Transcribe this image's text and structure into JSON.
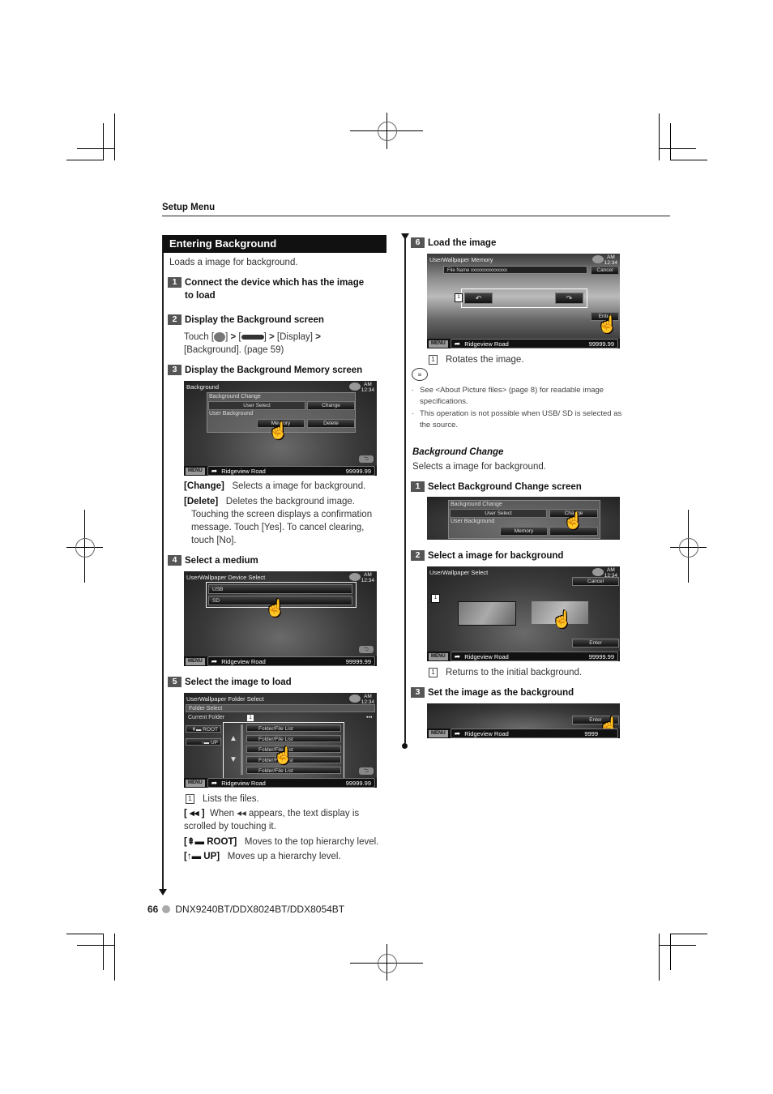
{
  "header": {
    "section": "Setup Menu"
  },
  "left": {
    "title": "Entering Background",
    "intro": "Loads a image for background.",
    "steps": [
      {
        "num": "1",
        "title_line1": "Connect the device which has the image",
        "title_line2": "to load"
      },
      {
        "num": "2",
        "title": "Display the Background screen",
        "touch_prefix": "Touch [",
        "touch_mid1": "] ",
        "touch_mid2": " [",
        "touch_mid3": "] ",
        "touch_display": " [Display] ",
        "touch_line2": "[Background]. (page 59)",
        "gt": ">"
      },
      {
        "num": "3",
        "title": "Display the Background Memory screen"
      },
      {
        "num": "4",
        "title": "Select a medium"
      },
      {
        "num": "5",
        "title": "Select the image to load"
      }
    ],
    "screen_bg": {
      "title": "Background",
      "clock_am": "AM",
      "clock_time": "12:34",
      "group1": "Background Change",
      "user_select": "User Select",
      "change": "Change",
      "group2": "User Background",
      "memory": "Memory",
      "delete": "Delete",
      "menu": "MENU",
      "road": "Ridgeview Road",
      "distance": "99999.99"
    },
    "desc_change_label": "[Change]",
    "desc_change_text": "Selects a image for background.",
    "desc_delete_label": "[Delete]",
    "desc_delete_text": "Deletes the background image.",
    "desc_delete_more": "Touching the screen displays a confirmation message. Touch [Yes]. To cancel clearing, touch [No].",
    "screen_device": {
      "title": "UserWallpaper Device Select",
      "clock_am": "AM",
      "clock_time": "12:34",
      "items": [
        "USB",
        "SD"
      ],
      "menu": "MENU",
      "road": "Ridgeview Road",
      "distance": "99999.99"
    },
    "screen_folder": {
      "title": "UserWallpaper Folder Select",
      "clock_am": "AM",
      "clock_time": "12:34",
      "folder_select": "Folder Select",
      "current_folder": "Current Folder",
      "root": "ROOT",
      "up": "UP",
      "files": [
        "Folder/File List",
        "Folder/File List",
        "Folder/File List",
        "Folder/File List",
        "Folder/File List"
      ],
      "scroll_glyph": "◂◂◂",
      "menu": "MENU",
      "road": "Ridgeview Road",
      "distance": "99999.99",
      "callout": "1"
    },
    "notes5": {
      "callout_num": "1",
      "callout_text": "Lists the files.",
      "scroll_label": "[ ◂◂ ]",
      "scroll_text": "When ◂◂ appears, the text display is scrolled by touching it.",
      "root_label": "ROOT]",
      "root_text": "Moves to the top hierarchy level.",
      "up_label": "UP]",
      "up_text": "Moves up a hierarchy level."
    }
  },
  "right": {
    "step6": {
      "num": "6",
      "title": "Load the image"
    },
    "screen_memory": {
      "title": "UserWallpaper Memory",
      "clock_am": "AM",
      "clock_time": "12:34",
      "file_name": "File Name xxxxxxxxxxxxxxx",
      "cancel": "Cancel",
      "enter": "Enter",
      "rotate_left": "↶",
      "rotate_right": "↷",
      "callout": "1",
      "menu": "MENU",
      "road": "Ridgeview Road",
      "distance": "99999.99"
    },
    "callout6_num": "1",
    "callout6_text": "Rotates the image.",
    "notes": [
      "See <About Picture files> (page 8) for readable image specifications.",
      "This operation is not possible when USB/ SD is selected as the source."
    ],
    "bg_change": {
      "title": "Background Change",
      "intro": "Selects a image for background."
    },
    "steps": [
      {
        "num": "1",
        "title": "Select Background Change screen"
      },
      {
        "num": "2",
        "title": "Select a image for background"
      },
      {
        "num": "3",
        "title": "Set the image as the background"
      }
    ],
    "screen_change": {
      "group1": "Background Change",
      "user_select": "User Select",
      "change": "Change",
      "group2": "User Background",
      "memory": "Memory"
    },
    "screen_select": {
      "title": "UserWallpaper Select",
      "clock_am": "AM",
      "clock_time": "12:34",
      "cancel": "Cancel",
      "enter": "Enter",
      "callout": "1",
      "menu": "MENU",
      "road": "Ridgeview Road",
      "distance": "99999.99"
    },
    "callout_select_num": "1",
    "callout_select_text": "Returns to the initial background.",
    "screen_enter": {
      "enter": "Enter",
      "menu": "MENU",
      "road": "Ridgeview Road",
      "distance": "9999"
    }
  },
  "footer": {
    "page": "66",
    "models": "DNX9240BT/DDX8024BT/DDX8054BT"
  }
}
